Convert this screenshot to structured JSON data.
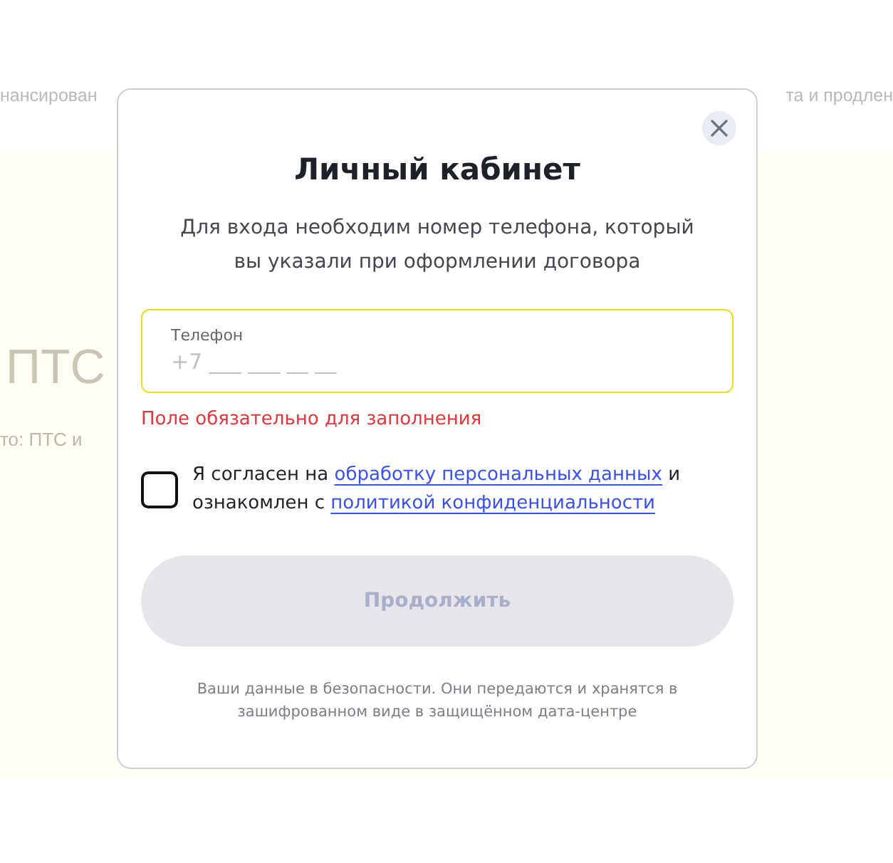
{
  "background": {
    "nav_left": "нансирован",
    "nav_right": "та и продлен",
    "heading": "ПТС",
    "subheading": "то: ПТС и"
  },
  "dialog": {
    "title": "Личный кабинет",
    "subtitle": "Для входа необходим номер телефона, который вы указали при оформлении договора",
    "phone_field": {
      "label": "Телефон",
      "placeholder": "+7 ___ ___ __ __",
      "error": "Поле обязательно для заполнения"
    },
    "consent": {
      "checked": false,
      "parts": [
        {
          "kind": "text",
          "text": "Я согласен на "
        },
        {
          "kind": "link",
          "text": "обработку персональных данных"
        },
        {
          "kind": "text",
          "text": " и ознакомлен с "
        },
        {
          "kind": "link",
          "text": "политикой конфиденциальности"
        }
      ]
    },
    "continue_button": {
      "label": "Продолжить",
      "disabled": true
    },
    "footer": "Ваши данные в безопасности. Они передаются и хранятся в зашифрованном виде в защищённом дата-центре"
  }
}
